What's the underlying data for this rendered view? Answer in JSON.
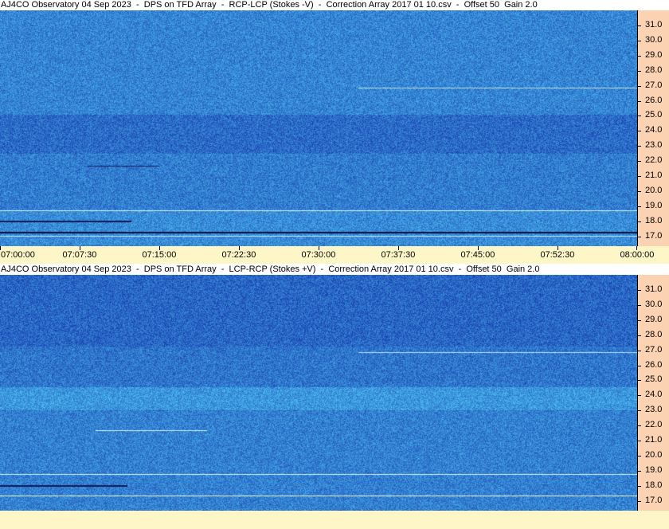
{
  "panels": [
    {
      "title": "AJ4CO Observatory 04 Sep 2023  -  DPS on TFD Array  -  RCP-LCP (Stokes -V)  -  Correction Array 2017 01 10.csv  -  Offset 50  Gain 2.0",
      "y_labels": [
        "31.0",
        "30.0",
        "29.0",
        "28.0",
        "27.0",
        "26.0",
        "25.0",
        "24.0",
        "23.0",
        "22.0",
        "21.0",
        "20.0",
        "19.0",
        "18.0",
        "17.0"
      ],
      "x_labels": [
        "07:00:00",
        "07:07:30",
        "07:15:00",
        "07:22:30",
        "07:30:00",
        "07:37:30",
        "07:45:00",
        "07:52:30",
        "08:00:00"
      ]
    },
    {
      "title": "AJ4CO Observatory 04 Sep 2023  -  DPS on TFD Array  -  LCP-RCP (Stokes +V)  -  Correction Array 2017 01 10.csv  -  Offset 50  Gain 2.0",
      "y_labels": [
        "31.0",
        "30.0",
        "29.0",
        "28.0",
        "27.0",
        "26.0",
        "25.0",
        "24.0",
        "23.0",
        "22.0",
        "21.0",
        "20.0",
        "19.0",
        "18.0",
        "17.0"
      ],
      "x_labels": []
    }
  ],
  "colors": {
    "spectrogram_base": "#2f6fdc",
    "axis_bg": "#fbd3b3",
    "time_axis_bg": "#fff6c8"
  }
}
